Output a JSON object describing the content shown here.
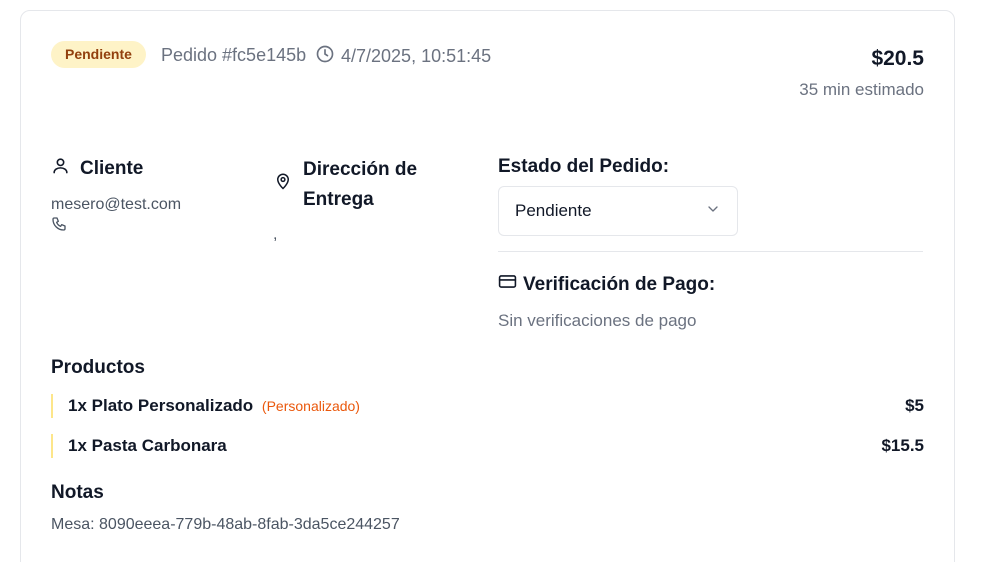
{
  "header": {
    "status_badge": "Pendiente",
    "order_id": "Pedido #fc5e145b",
    "timestamp": "4/7/2025, 10:51:45",
    "total": "$20.5",
    "eta": "35 min estimado"
  },
  "client": {
    "title": "Cliente",
    "email": "mesero@test.com"
  },
  "address": {
    "title": "Dirección de Entrega",
    "text": ","
  },
  "order_status": {
    "label": "Estado del Pedido:",
    "selected": "Pendiente"
  },
  "payment": {
    "title": "Verificación de Pago:",
    "empty_text": "Sin verificaciones de pago"
  },
  "products": {
    "title": "Productos",
    "items": [
      {
        "name": "1x Plato Personalizado",
        "tag": "(Personalizado)",
        "price": "$5"
      },
      {
        "name": "1x Pasta Carbonara",
        "tag": "",
        "price": "$15.5"
      }
    ]
  },
  "notes": {
    "title": "Notas",
    "text": "Mesa: 8090eeea-779b-48ab-8fab-3da5ce244257"
  },
  "colors": {
    "badge_bg": "#fef3c7",
    "badge_text": "#92400e",
    "accent_orange": "#ea580c",
    "product_border": "#fde68a"
  },
  "icons": [
    "clock-icon",
    "user-icon",
    "phone-icon",
    "map-pin-icon",
    "chevron-down-icon",
    "credit-card-icon"
  ]
}
